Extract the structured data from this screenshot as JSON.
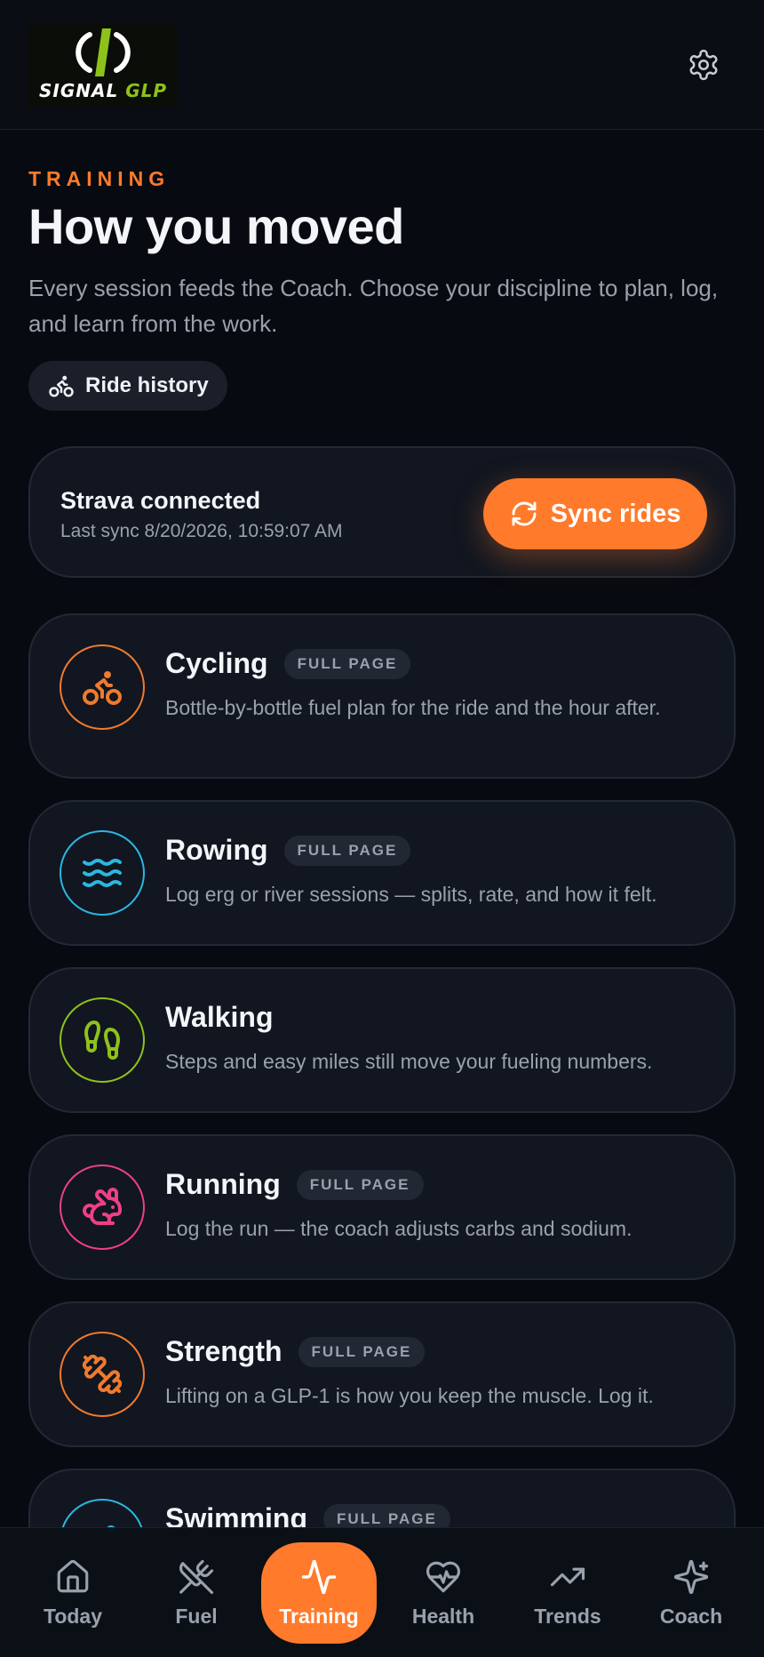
{
  "header": {
    "logo_text_signal": "SIGNAL",
    "logo_text_glp": "GLP",
    "settings_icon": "gear-icon"
  },
  "hero": {
    "eyebrow": "TRAINING",
    "title": "How you moved",
    "subtitle": "Every session feeds the Coach. Choose your discipline to plan, log, and learn from the work.",
    "history_button": "Ride history"
  },
  "strava": {
    "title": "Strava connected",
    "last_sync": "Last sync 8/20/2026, 10:59:07 AM",
    "sync_button": "Sync rides"
  },
  "disciplines": [
    {
      "name": "Cycling",
      "badge": "FULL PAGE",
      "desc": "Bottle-by-bottle fuel plan for the ride and the hour after.",
      "icon": "bike-icon",
      "color": "#f07a2e"
    },
    {
      "name": "Rowing",
      "badge": "FULL PAGE",
      "desc": "Log erg or river sessions — splits, rate, and how it felt.",
      "icon": "waves-icon",
      "color": "#2bb7e0"
    },
    {
      "name": "Walking",
      "badge": "",
      "desc": "Steps and easy miles still move your fueling numbers.",
      "icon": "footprints-icon",
      "color": "#8ec21a"
    },
    {
      "name": "Running",
      "badge": "FULL PAGE",
      "desc": "Log the run — the coach adjusts carbs and sodium.",
      "icon": "rabbit-icon",
      "color": "#ef3f86"
    },
    {
      "name": "Strength",
      "badge": "FULL PAGE",
      "desc": "Lifting on a GLP-1 is how you keep the muscle. Log it.",
      "icon": "dumbbell-icon",
      "color": "#f07a2e"
    },
    {
      "name": "Swimming",
      "badge": "FULL PAGE",
      "desc": "",
      "icon": "swim-icon",
      "color": "#2bb7e0"
    }
  ],
  "nav": {
    "items": [
      {
        "label": "Today",
        "icon": "home-icon"
      },
      {
        "label": "Fuel",
        "icon": "utensils-icon"
      },
      {
        "label": "Training",
        "icon": "activity-icon"
      },
      {
        "label": "Health",
        "icon": "heart-pulse-icon"
      },
      {
        "label": "Trends",
        "icon": "trending-up-icon"
      },
      {
        "label": "Coach",
        "icon": "sparkles-icon"
      }
    ],
    "active": "Training"
  }
}
